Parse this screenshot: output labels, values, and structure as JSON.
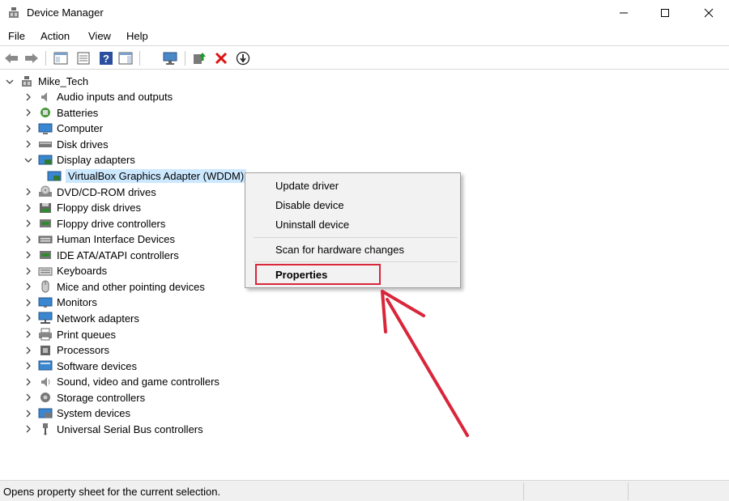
{
  "window": {
    "title": "Device Manager"
  },
  "menu": [
    "File",
    "Action",
    "View",
    "Help"
  ],
  "toolbar_icons": [
    "back-icon",
    "forward-icon",
    "show-hide-console-tree-icon",
    "properties-icon",
    "help-icon",
    "action-pane-icon",
    "scan-hardware-icon",
    "update-driver-icon",
    "uninstall-icon",
    "disable-device-icon"
  ],
  "tree": {
    "root": "Mike_Tech",
    "categories": [
      {
        "label": "Audio inputs and outputs",
        "icon": "speaker-icon"
      },
      {
        "label": "Batteries",
        "icon": "battery-icon"
      },
      {
        "label": "Computer",
        "icon": "computer-icon"
      },
      {
        "label": "Disk drives",
        "icon": "disk-drive-icon"
      },
      {
        "label": "Display adapters",
        "icon": "display-adapter-icon"
      },
      {
        "label": "VirtualBox Graphics Adapter (WDDM)",
        "icon": "display-adapter-icon"
      },
      {
        "label": "DVD/CD-ROM drives",
        "icon": "dvd-icon"
      },
      {
        "label": "Floppy disk drives",
        "icon": "floppy-icon"
      },
      {
        "label": "Floppy drive controllers",
        "icon": "controller-icon"
      },
      {
        "label": "Human Interface Devices",
        "icon": "hid-icon"
      },
      {
        "label": "IDE ATA/ATAPI controllers",
        "icon": "controller-icon"
      },
      {
        "label": "Keyboards",
        "icon": "keyboard-icon"
      },
      {
        "label": "Mice and other pointing devices",
        "icon": "mouse-icon"
      },
      {
        "label": "Monitors",
        "icon": "monitor-icon"
      },
      {
        "label": "Network adapters",
        "icon": "network-icon"
      },
      {
        "label": "Print queues",
        "icon": "printer-icon"
      },
      {
        "label": "Processors",
        "icon": "processor-icon"
      },
      {
        "label": "Software devices",
        "icon": "software-device-icon"
      },
      {
        "label": "Sound, video and game controllers",
        "icon": "sound-icon"
      },
      {
        "label": "Storage controllers",
        "icon": "storage-icon"
      },
      {
        "label": "System devices",
        "icon": "system-device-icon"
      },
      {
        "label": "Universal Serial Bus controllers",
        "icon": "usb-icon"
      }
    ]
  },
  "context_menu": {
    "items": [
      "Update driver",
      "Disable device",
      "Uninstall device",
      "Scan for hardware changes",
      "Properties"
    ]
  },
  "status": {
    "text": "Opens property sheet for the current selection."
  },
  "colors": {
    "selection": "#cce8ff",
    "annotation": "#d9263a"
  }
}
